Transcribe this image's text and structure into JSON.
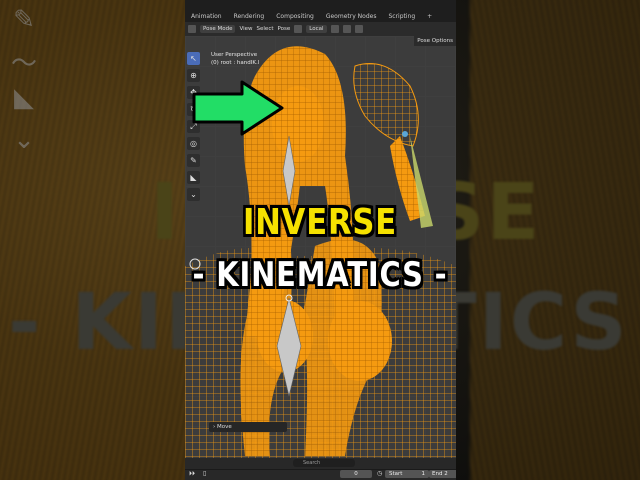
{
  "top_tabs": [
    "Animation",
    "Rendering",
    "Compositing",
    "Geometry Nodes",
    "Scripting",
    "+"
  ],
  "header": {
    "mode": "Pose Mode",
    "menu": [
      "View",
      "Select",
      "Pose"
    ],
    "transform_orientation": "Local",
    "n_panel_tab": "Pose Options"
  },
  "viewport": {
    "perspective": "User Perspective",
    "active_object": "(0) root : handIK.l"
  },
  "toolbar_icons": [
    "cursor-select-icon",
    "cursor-3d-icon",
    "move-icon",
    "rotate-icon",
    "scale-icon",
    "transform-icon",
    "annotate-icon",
    "measure-icon",
    "bone-relax-icon"
  ],
  "last_operator": "Move",
  "timeline": {
    "search_placeholder": "Search",
    "current_frame": "0",
    "start_label": "Start",
    "start_value": "1",
    "end_label": "End",
    "end_value": "2"
  },
  "overlay": {
    "line1": "INVERSE",
    "line2": "- KINEMATICS -"
  },
  "colors": {
    "mesh_wireframe": "#f59a10",
    "arrow": "#22dd66",
    "title_yellow": "#f6e200",
    "viewport_bg": "#3c3c3c"
  }
}
